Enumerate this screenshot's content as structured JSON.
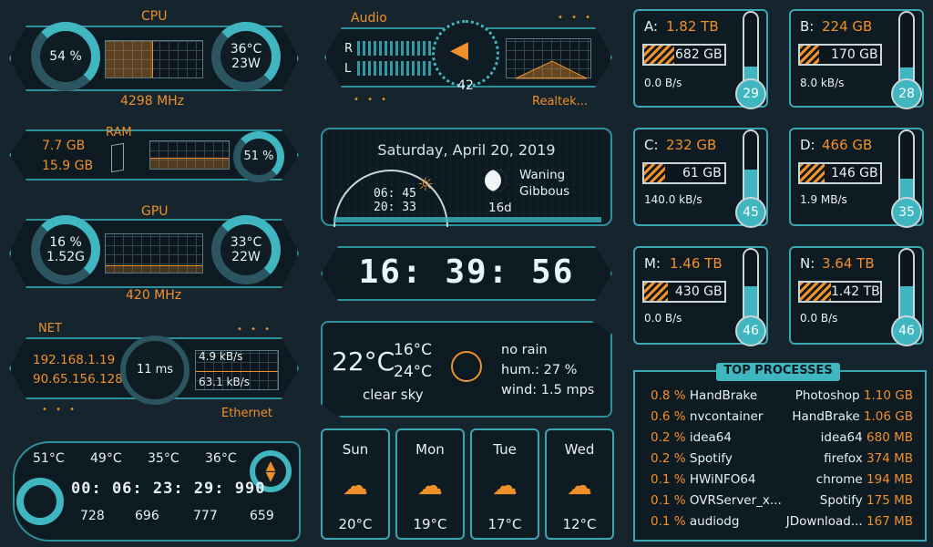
{
  "cpu": {
    "title": "CPU",
    "load": "54 %",
    "temp": "36°C",
    "power": "23W",
    "clock": "4298 MHz"
  },
  "ram": {
    "title": "RAM",
    "used": "7.7 GB",
    "total": "15.9 GB",
    "load": "51 %"
  },
  "gpu": {
    "title": "GPU",
    "load": "16 %",
    "mem": "1.52G",
    "temp": "33°C",
    "power": "22W",
    "clock": "420 MHz"
  },
  "net": {
    "title": "NET",
    "ip_local": "192.168.1.19",
    "ip_public": "90.65.156.128",
    "ping": "11 ms",
    "up": "4.9 kB/s",
    "down": "63.1 kB/s",
    "adapter": "Ethernet"
  },
  "temps": {
    "t1": "51°C",
    "t2": "49°C",
    "t3": "35°C",
    "t4": "36°C",
    "uptime": "00: 06: 23: 29: 990",
    "v1": "728",
    "v2": "696",
    "v3": "777",
    "v4": "659"
  },
  "audio": {
    "title": "Audio",
    "left": "L",
    "right": "R",
    "volume": "42",
    "device": "Realtek..."
  },
  "date": {
    "text": "Saturday, April 20, 2019",
    "sunrise": "06: 45",
    "sunset": "20: 33",
    "moon_phase_1": "Waning",
    "moon_phase_2": "Gibbous",
    "moon_age": "16d"
  },
  "clock": {
    "time": "16: 39: 56"
  },
  "weather": {
    "temp": "22°C",
    "low": "16°C",
    "high": "24°C",
    "condition": "clear sky",
    "rain": "no rain",
    "humidity": "hum.: 27 %",
    "wind": "wind: 1.5 mps"
  },
  "forecast": [
    {
      "day": "Sun",
      "temp": "20°C"
    },
    {
      "day": "Mon",
      "temp": "19°C"
    },
    {
      "day": "Tue",
      "temp": "17°C"
    },
    {
      "day": "Wed",
      "temp": "12°C"
    }
  ],
  "drives": [
    {
      "label": "A:",
      "size": "1.82 TB",
      "used": "682 GB",
      "rate": "0.0 B/s",
      "temp": "29",
      "fill": 0.37
    },
    {
      "label": "B:",
      "size": "224 GB",
      "used": "170 GB",
      "rate": "8.0 kB/s",
      "temp": "28",
      "fill": 0.76
    },
    {
      "label": "C:",
      "size": "232 GB",
      "used": "61 GB",
      "rate": "140.0 kB/s",
      "temp": "45",
      "fill": 0.26
    },
    {
      "label": "D:",
      "size": "466 GB",
      "used": "146 GB",
      "rate": "1.9 MB/s",
      "temp": "35",
      "fill": 0.31
    },
    {
      "label": "M:",
      "size": "1.46 TB",
      "used": "430 GB",
      "rate": "0.0 B/s",
      "temp": "46",
      "fill": 0.29
    },
    {
      "label": "N:",
      "size": "3.64 TB",
      "used": "1.42 TB",
      "rate": "0.0 B/s",
      "temp": "46",
      "fill": 0.39
    }
  ],
  "processes": {
    "title": "TOP PROCESSES",
    "cpu": [
      {
        "pct": "0.8 %",
        "name": "HandBrake"
      },
      {
        "pct": "0.6 %",
        "name": "nvcontainer"
      },
      {
        "pct": "0.2 %",
        "name": "idea64"
      },
      {
        "pct": "0.2 %",
        "name": "Spotify"
      },
      {
        "pct": "0.1 %",
        "name": "HWiNFO64"
      },
      {
        "pct": "0.1 %",
        "name": "OVRServer_x..."
      },
      {
        "pct": "0.1 %",
        "name": "audiodg"
      }
    ],
    "mem": [
      {
        "name": "Photoshop",
        "size": "1.10 GB"
      },
      {
        "name": "HandBrake",
        "size": "1.06 GB"
      },
      {
        "name": "idea64",
        "size": "680 MB"
      },
      {
        "name": "firefox",
        "size": "374 MB"
      },
      {
        "name": "chrome",
        "size": "194 MB"
      },
      {
        "name": "Spotify",
        "size": "175 MB"
      },
      {
        "name": "JDownload...",
        "size": "167 MB"
      }
    ]
  }
}
